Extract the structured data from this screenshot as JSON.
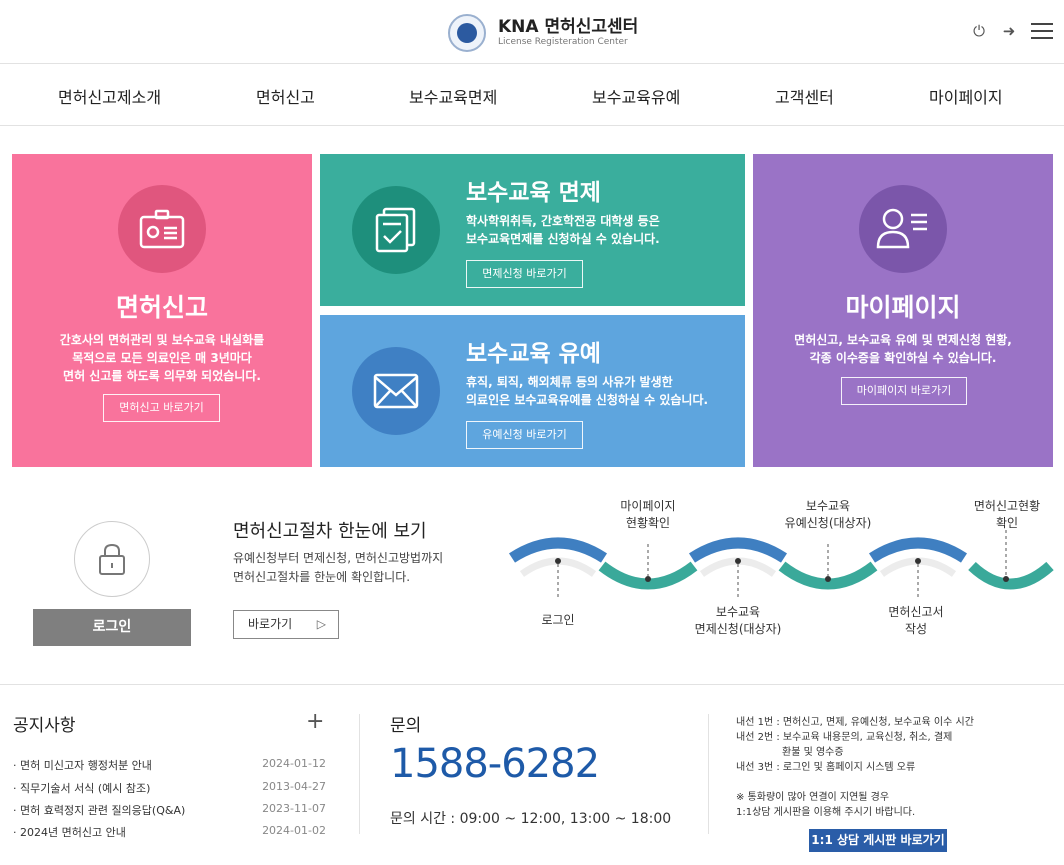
{
  "header": {
    "logo_title": "KNA 면허신고센터",
    "logo_sub": "License Registeration Center",
    "power_icon": "⏻",
    "logout_icon": "➜"
  },
  "nav": [
    "면허신고제소개",
    "면허신고",
    "보수교육면제",
    "보수교육유예",
    "고객센터",
    "마이페이지"
  ],
  "cards": {
    "license": {
      "title": "면허신고",
      "desc": [
        "간호사의 면허관리 및 보수교육 내실화를",
        "목적으로 모든 의료인은 매 3년마다",
        "면허 신고를 하도록 의무화 되었습니다."
      ],
      "button": "면허신고 바로가기"
    },
    "exemption": {
      "title": "보수교육 면제",
      "desc": [
        "학사학위취득, 간호학전공 대학생 등은",
        "보수교육면제를 신청하실 수 있습니다."
      ],
      "button": "면제신청 바로가기"
    },
    "deferral": {
      "title": "보수교육 유예",
      "desc": [
        "휴직, 퇴직, 해외체류 등의 사유가 발생한",
        "의료인은 보수교육유예를 신청하실 수 있습니다."
      ],
      "button": "유예신청 바로가기"
    },
    "mypage": {
      "title": "마이페이지",
      "desc": [
        "면허신고, 보수교육 유예 및 면제신청 현황,",
        "각종 이수증을 확인하실 수 있습니다."
      ],
      "button": "마이페이지 바로가기"
    }
  },
  "process": {
    "login_button": "로그인",
    "title": "면허신고절차 한눈에 보기",
    "desc": [
      "유예신청부터 면제신청, 면허신고방법까지",
      "면허신고절차를 한눈에 확인합니다."
    ],
    "go_button": "바로가기",
    "go_arrow": "▷",
    "steps_top": [
      {
        "lines": [
          "마이페이지",
          "현황확인"
        ]
      },
      {
        "lines": [
          "보수교육",
          "유예신청(대상자)"
        ]
      },
      {
        "lines": [
          "면허신고현황",
          "확인"
        ]
      }
    ],
    "steps_bottom": [
      {
        "lines": [
          "로그인"
        ]
      },
      {
        "lines": [
          "보수교육",
          "면제신청(대상자)"
        ]
      },
      {
        "lines": [
          "면허신고서",
          "작성"
        ]
      }
    ],
    "colors": {
      "blue": "#3f7fc1",
      "teal": "#3aa99a"
    }
  },
  "notice": {
    "title": "공지사항",
    "plus": "+",
    "items": [
      {
        "title": "· 면허 미신고자 행정처분 안내",
        "date": "2024-01-12"
      },
      {
        "title": "· 직무기술서 서식 (예시 참조)",
        "date": "2013-04-27"
      },
      {
        "title": "· 면허 효력정지 관련 질의응답(Q&A)",
        "date": "2023-11-07"
      },
      {
        "title": "· 2024년 면허신고 안내",
        "date": "2024-01-02"
      }
    ]
  },
  "inquiry": {
    "label": "문의",
    "phone": "1588-6282",
    "hours": "문의 시간 : 09:00 ~ 12:00, 13:00 ~ 18:00"
  },
  "extensions": {
    "lines": [
      "내선 1번 : 면허신고, 면제, 유예신청, 보수교육 이수 시간",
      "내선 2번 : 보수교육 내용문의, 교육신청, 취소, 결제",
      "             환불 및 영수증",
      "내선 3번 : 로그인 및 홈페이지 시스템 오류"
    ],
    "notes": [
      "※ 통화량이 많아 연결이 지연될 경우",
      "   1:1상담 게시판을 이용해 주시기 바랍니다."
    ],
    "button": "1:1 상담 게시판 바로가기"
  }
}
